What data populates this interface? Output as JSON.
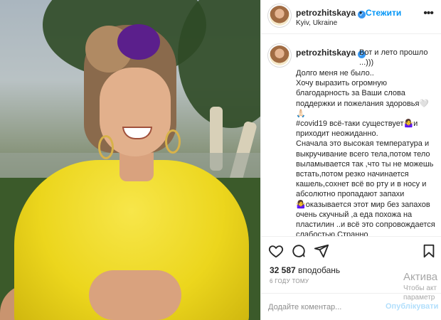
{
  "post": {
    "username": "petrozhitskaya",
    "dot": "•",
    "follow_label": "Стежити",
    "location": "Kyiv, Ukraine",
    "more_label": "•••"
  },
  "caption": {
    "username": "petrozhitskaya",
    "first_line": "Вот и лето прошло ...)))",
    "lines": [
      "Долго меня не было..",
      "Хочу выразить огромную благодарность за Ваши слова поддержки и пожелания здоровья🤍🙏🏻",
      "#covid19 всё-таки существует🤷‍♀️и приходит неожиданно.",
      "Сначала это высокая температура и выкручивание всего тела,потом тело выламывается так ,что ты не можешь встать,потом резко начинается кашель,сохнет всё во рту и в носу и абсолютно пропадают запахи🤷‍♀️оказывается этот мир без запахов очень скучный ,а еда похожа на пластилин ..и всё это сопровождается слабостью.Странно"
    ]
  },
  "icons": {
    "like": "heart-icon",
    "comment": "comment-icon",
    "share": "share-icon",
    "save": "bookmark-icon",
    "verified": "verified-badge-icon"
  },
  "stats": {
    "likes_count": "32 587",
    "likes_label": "вподобань",
    "time_ago": "6 ГОДУ ТОМУ"
  },
  "comment": {
    "placeholder": "Додайте коментар...",
    "publish_label": "Опублікувати"
  },
  "windows_activation": {
    "line1": "Актива",
    "line2": "Чтобы акт",
    "line3": "параметр"
  },
  "colors": {
    "accent": "#0095f6",
    "publish_disabled": "#b2dffc",
    "dress": "#ecd61d",
    "scrunchie": "#5b1f8c"
  }
}
